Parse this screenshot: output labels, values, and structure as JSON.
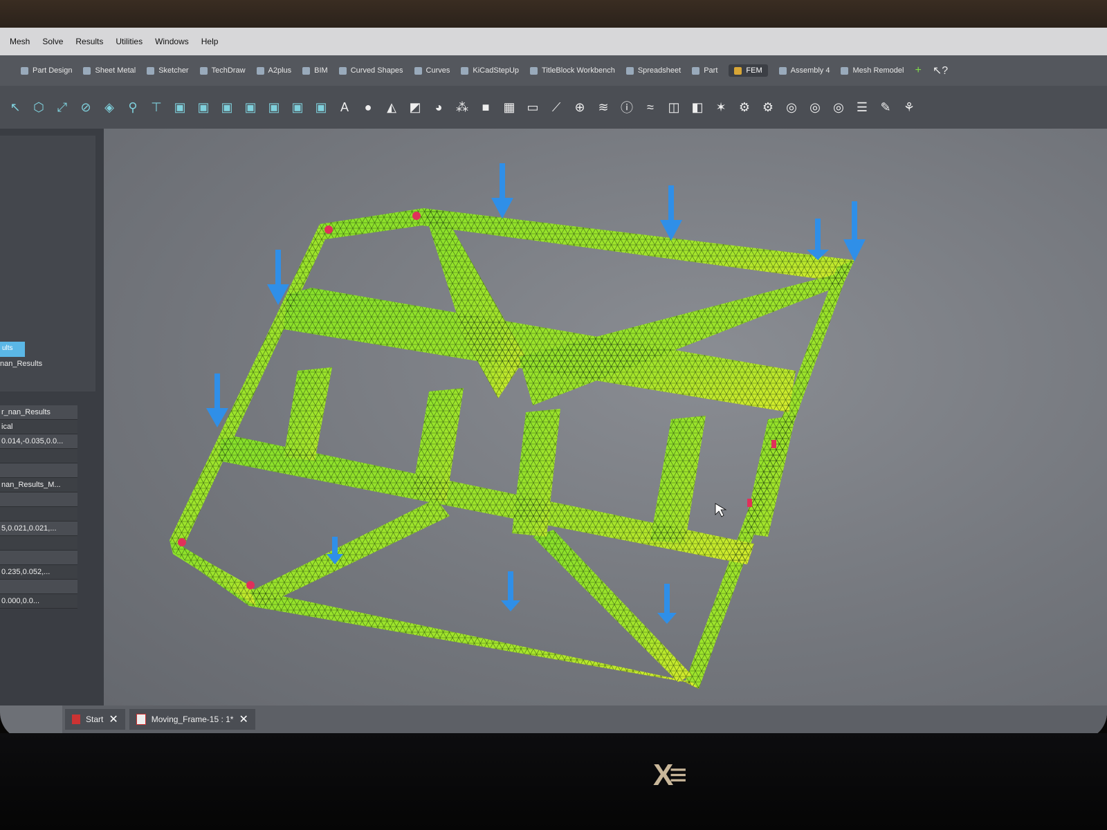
{
  "menu": [
    "Mesh",
    "Solve",
    "Results",
    "Utilities",
    "Windows",
    "Help"
  ],
  "workbenches": [
    "Part Design",
    "Sheet Metal",
    "Sketcher",
    "TechDraw",
    "A2plus",
    "BIM",
    "Curved Shapes",
    "Curves",
    "KiCadStepUp",
    "TitleBlock Workbench",
    "Spreadsheet",
    "Part",
    "FEM",
    "Assembly 4",
    "Mesh Remodel"
  ],
  "active_workbench": "FEM",
  "tree": {
    "selected_label": "ults",
    "item_label": "nan_Results"
  },
  "properties": [
    "r_nan_Results",
    "ical",
    "0.014,-0.035,0.0...",
    "",
    "",
    "nan_Results_M...",
    "",
    "",
    "5,0.021,0.021,...",
    "",
    "",
    "0.235,0.052,...",
    "",
    "0.000,0.0..."
  ],
  "doc_tabs": [
    {
      "label": "Start"
    },
    {
      "label": "Moving_Frame-15 : 1*"
    }
  ],
  "colors": {
    "mesh_green": "#7ed321",
    "mesh_yellow": "#d6ea2a",
    "load_arrow": "#2f8fe8",
    "constraint": "#e0305a"
  }
}
